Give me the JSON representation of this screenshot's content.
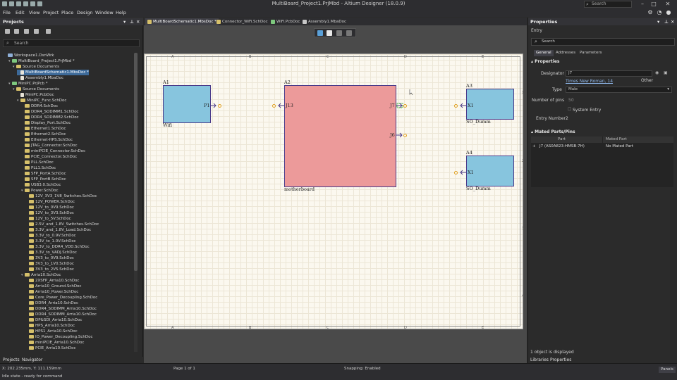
{
  "window": {
    "title": "MultiBoard_Project1.PrjMbd - Altium Designer (18.0.9)",
    "search_placeholder": "Search",
    "min": "–",
    "max": "□",
    "close": "✕"
  },
  "menu": [
    "File",
    "Edit",
    "View",
    "Project",
    "Place",
    "Design",
    "Window",
    "Help"
  ],
  "projects_panel": {
    "title": "Projects",
    "search_placeholder": "Search",
    "tree": [
      {
        "label": "Workspace1.DsnWrk",
        "level": 0,
        "icon": "ws"
      },
      {
        "label": "MultiBoard_Project1.PrjMbd *",
        "level": 1,
        "icon": "prj",
        "arrow": "▾"
      },
      {
        "label": "Source Documents",
        "level": 2,
        "icon": "folder",
        "arrow": "▾"
      },
      {
        "label": "MultiBoardSchematic1.MbsDoc *",
        "level": 3,
        "icon": "doc",
        "selected": true
      },
      {
        "label": "Assembly1.MbaDoc",
        "level": 3,
        "icon": "doc"
      },
      {
        "label": "MiniPC.PrjPcb *",
        "level": 1,
        "icon": "prj",
        "arrow": "▾"
      },
      {
        "label": "Source Documents",
        "level": 2,
        "icon": "folder",
        "arrow": "▾"
      },
      {
        "label": "MiniPC.PcbDoc",
        "level": 3,
        "icon": "doc"
      },
      {
        "label": "MiniPC_Func.SchDoc",
        "level": 3,
        "icon": "folder",
        "arrow": "▾"
      },
      {
        "label": "DDR4.SchDoc",
        "level": 4,
        "icon": "folder"
      },
      {
        "label": "DDR4_SODIMM1.SchDoc",
        "level": 4,
        "icon": "folder"
      },
      {
        "label": "DDR4_SODIMM2.SchDoc",
        "level": 4,
        "icon": "folder"
      },
      {
        "label": "Display_Port.SchDoc",
        "level": 4,
        "icon": "folder"
      },
      {
        "label": "Ethernet1.SchDoc",
        "level": 4,
        "icon": "folder"
      },
      {
        "label": "Ethernet2.SchDoc",
        "level": 4,
        "icon": "folder"
      },
      {
        "label": "Ethernet-HPS.SchDoc",
        "level": 4,
        "icon": "folder"
      },
      {
        "label": "JTAG_Connector.SchDoc",
        "level": 4,
        "icon": "folder"
      },
      {
        "label": "miniPCIE_Connector.SchDoc",
        "level": 4,
        "icon": "folder"
      },
      {
        "label": "PCIE_Connector.SchDoc",
        "level": 4,
        "icon": "folder"
      },
      {
        "label": "PLL.SchDoc",
        "level": 4,
        "icon": "folder"
      },
      {
        "label": "PLL1.SchDoc",
        "level": 4,
        "icon": "folder"
      },
      {
        "label": "SFP_PortA.SchDoc",
        "level": 4,
        "icon": "folder"
      },
      {
        "label": "SFP_PortB.SchDoc",
        "level": 4,
        "icon": "folder"
      },
      {
        "label": "USB3.0.SchDoc",
        "level": 4,
        "icon": "folder"
      },
      {
        "label": "Power.SchDoc",
        "level": 4,
        "icon": "folder",
        "arrow": "▾"
      },
      {
        "label": "12V_3V3_1V8_Switches.SchDoc",
        "level": 5,
        "icon": "folder"
      },
      {
        "label": "12V_POWER.SchDoc",
        "level": 5,
        "icon": "folder"
      },
      {
        "label": "12V_to_0V9.SchDoc",
        "level": 5,
        "icon": "folder"
      },
      {
        "label": "12V_to_3V3.SchDoc",
        "level": 5,
        "icon": "folder"
      },
      {
        "label": "12V_to_5V.SchDoc",
        "level": 5,
        "icon": "folder"
      },
      {
        "label": "2.5V_and_1.8V_Switches.SchDoc",
        "level": 5,
        "icon": "folder"
      },
      {
        "label": "3.3V_and_1.8V_Load.SchDoc",
        "level": 5,
        "icon": "folder"
      },
      {
        "label": "3.3V_to_0.9V.SchDoc",
        "level": 5,
        "icon": "folder"
      },
      {
        "label": "3.3V_to_1.0V.SchDoc",
        "level": 5,
        "icon": "folder"
      },
      {
        "label": "3.3V_to_DDR4_VDD.SchDoc",
        "level": 5,
        "icon": "folder"
      },
      {
        "label": "3.3V_to_VADJ.SchDoc",
        "level": 5,
        "icon": "folder"
      },
      {
        "label": "3V3_to_0V9.SchDoc",
        "level": 5,
        "icon": "folder"
      },
      {
        "label": "3V3_to_1V0.SchDoc",
        "level": 5,
        "icon": "folder"
      },
      {
        "label": "3V3_to_2V5.SchDoc",
        "level": 5,
        "icon": "folder"
      },
      {
        "label": "Arria10.SchDoc",
        "level": 4,
        "icon": "folder",
        "arrow": "▾"
      },
      {
        "label": "2XSFP_Arria10.SchDoc",
        "level": 5,
        "icon": "folder"
      },
      {
        "label": "Arria10_Ground.SchDoc",
        "level": 5,
        "icon": "folder"
      },
      {
        "label": "Arria10_Power.SchDoc",
        "level": 5,
        "icon": "folder"
      },
      {
        "label": "Core_Power_Decoupling.SchDoc",
        "level": 5,
        "icon": "folder"
      },
      {
        "label": "DDR4_Arria10.SchDoc",
        "level": 5,
        "icon": "folder"
      },
      {
        "label": "DDR4_SODIMM_Arria10.SchDoc",
        "level": 5,
        "icon": "folder"
      },
      {
        "label": "DDR4_SODIMM_Arria10.SchDoc",
        "level": 5,
        "icon": "folder"
      },
      {
        "label": "DP&SDI_Arria10.SchDoc",
        "level": 5,
        "icon": "folder"
      },
      {
        "label": "HPS_Arria10.SchDoc",
        "level": 5,
        "icon": "folder"
      },
      {
        "label": "HPS1_Arria10.SchDoc",
        "level": 5,
        "icon": "folder"
      },
      {
        "label": "IO_Power_Decoupling.SchDoc",
        "level": 5,
        "icon": "folder"
      },
      {
        "label": "miniPCIE_Arria10.SchDoc",
        "level": 5,
        "icon": "folder"
      },
      {
        "label": "PCIE_Arria10.SchDoc",
        "level": 5,
        "icon": "folder"
      }
    ],
    "bottom_tabs": [
      "Projects",
      "Navigator"
    ]
  },
  "doc_tabs": [
    {
      "label": "MultiBoardSchematic1.MbsDoc *",
      "active": true
    },
    {
      "label": "Connector_WiFi.SchDoc",
      "active": false
    },
    {
      "label": "WiFi.PcbDoc",
      "active": false
    },
    {
      "label": "Assembly1.MbaDoc",
      "active": false
    }
  ],
  "schematic": {
    "zones_top": [
      "A",
      "B",
      "C",
      "D",
      "E"
    ],
    "zones_side": [
      "1",
      "2",
      "3",
      "4"
    ],
    "blocks": [
      {
        "id": "A1",
        "name": "Wifi",
        "color": "#87c5de"
      },
      {
        "id": "A2",
        "name": "motherboard",
        "color": "#ec9a9a"
      },
      {
        "id": "A3",
        "name": "SO_Dumm",
        "color": "#87c5de"
      },
      {
        "id": "A4",
        "name": "SO_Dumm",
        "color": "#87c5de"
      }
    ],
    "ports": {
      "wifi_p1": "P1",
      "mb_j13": "J13",
      "mb_j7": "J7",
      "mb_j5": "J6",
      "a3_x1": "X1",
      "a4_x1": "X1"
    }
  },
  "properties_panel": {
    "title": "Properties",
    "object_type": "Entry",
    "search_placeholder": "Search",
    "tabs": [
      "General",
      "Addresses",
      "Parameters"
    ],
    "section_properties": "Properties",
    "designator_label": "Designator",
    "designator_value": "J7",
    "font_value": "Times New Roman, 14",
    "font_other": "Other",
    "type_label": "Type",
    "type_value": "Male",
    "pins_label": "Number of pins",
    "pins_value": "50",
    "system_entry": "System Entry",
    "entry_number_label": "Entry Number",
    "entry_number_value": "2",
    "section_mated": "Mated Parts/Pins",
    "mated_headers": [
      "Part",
      "Mated Part"
    ],
    "mated_part": "J7 (AS0A823-HMSB-7H)",
    "mated_value": "No Mated Part",
    "status": "1 object is displayed",
    "bottom_tabs": [
      "Libraries",
      "Properties"
    ]
  },
  "statusbar": {
    "coords": "X: 202.235mm, Y: 111.159mm",
    "state": "Idle state - ready for command",
    "page": "Page 1 of 1",
    "snapping": "Snapping: Enabled",
    "panels": "Panels"
  }
}
